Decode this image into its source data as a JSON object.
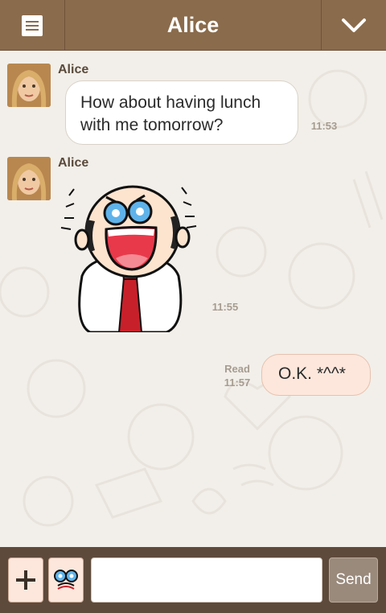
{
  "header": {
    "title": "Alice"
  },
  "messages": [
    {
      "type": "text",
      "sender": "Alice",
      "text_line1": "How about having lunch",
      "text_line2": "with me tomorrow?",
      "time": "11:53"
    },
    {
      "type": "sticker",
      "sender": "Alice",
      "sticker": "laughing-bald-man-sticker",
      "time": "11:55"
    },
    {
      "type": "text-out",
      "text": "O.K. *^^*",
      "status": "Read",
      "time": "11:57"
    }
  ],
  "composer": {
    "send_label": "Send",
    "placeholder": ""
  },
  "colors": {
    "header": "#8a6b4c",
    "bottom_bar": "#5e4a3b",
    "outgoing_bubble": "#fde7dc",
    "incoming_bubble": "#ffffff"
  }
}
